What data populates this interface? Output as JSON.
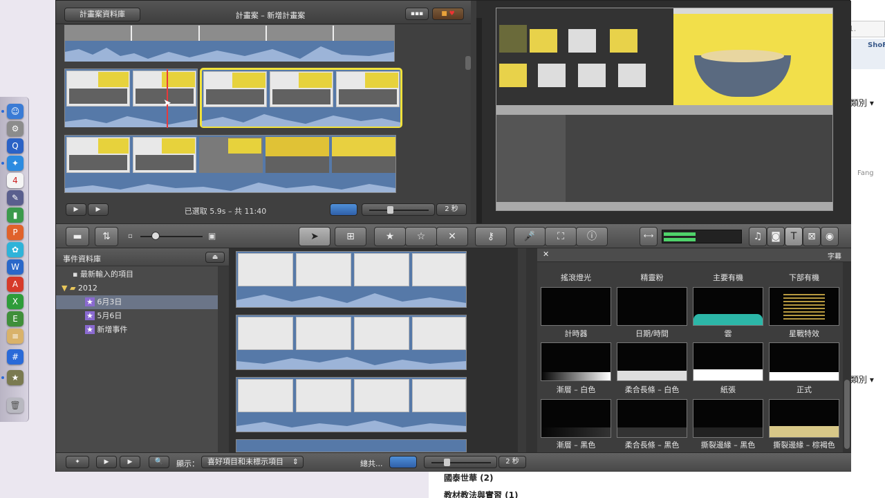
{
  "window": {
    "back_button": "計畫案資料庫",
    "project_title": "計畫案 – 新增計畫案",
    "selection_status": "已選取 5.9s – 共 11:40",
    "project_zoom": "2 秒"
  },
  "events_library": {
    "header": "事件資料庫",
    "items": [
      {
        "label": "最新輸入的項目"
      },
      {
        "label": "2012"
      },
      {
        "label": "6月3日"
      },
      {
        "label": "5月6日"
      },
      {
        "label": "新增事件"
      }
    ]
  },
  "titles_panel": {
    "header": "字幕",
    "items": [
      "搖滾燈光",
      "精靈粉",
      "主要有機",
      "下部有機",
      "計時器",
      "日期/時間",
      "雲",
      "星戰特效",
      "漸層 – 白色",
      "柔合長條 – 白色",
      "紙張",
      "正式",
      "漸層 – 黑色",
      "柔合長條 – 黑色",
      "撕裂邊緣 – 黑色",
      "撕裂邊緣 – 棕褐色"
    ]
  },
  "bottom_bar": {
    "show_label": "顯示：",
    "filter_value": "喜好項目和未標示項目",
    "total_label": "總共...",
    "zoom": "2 秒"
  },
  "background_page": {
    "category_1": "類別 ▾",
    "category_2": "類別 ▾",
    "tab": "ShoF",
    "name": "Fang",
    "list_1": "國泰世華 (2)",
    "list_2": "教材教法與實習 (1)"
  },
  "colors": {
    "selection_yellow": "#f2e23a",
    "playhead_red": "#e83a3a",
    "audio_blue": "#5679a8",
    "accent_green": "#4fd36a"
  }
}
